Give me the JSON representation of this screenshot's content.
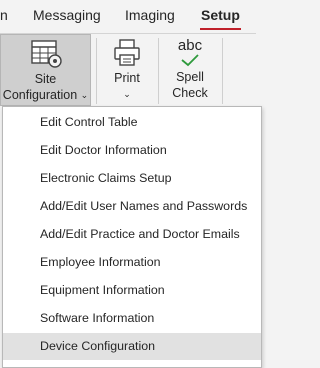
{
  "menubar": {
    "tabs": [
      {
        "label": "n"
      },
      {
        "label": "Messaging"
      },
      {
        "label": "Imaging"
      },
      {
        "label": "Setup",
        "active": true
      }
    ],
    "accent_color": "#c0202a"
  },
  "ribbon": {
    "site_configuration": {
      "line1": "Site",
      "line2": "Configuration",
      "caret": "⌄",
      "icon": "table-config-icon"
    },
    "print": {
      "label": "Print",
      "caret": "⌄",
      "icon": "printer-icon"
    },
    "spell_check": {
      "abc": "abc",
      "line1": "Spell",
      "line2": "Check",
      "icon": "spell-check-icon"
    }
  },
  "dropdown": {
    "items": [
      {
        "label": "Edit Control Table"
      },
      {
        "label": "Edit Doctor Information"
      },
      {
        "label": "Electronic Claims Setup"
      },
      {
        "label": "Add/Edit User Names and Passwords"
      },
      {
        "label": "Add/Edit Practice and Doctor Emails"
      },
      {
        "label": "Employee Information"
      },
      {
        "label": "Equipment Information"
      },
      {
        "label": "Software Information"
      },
      {
        "label": "Device Configuration"
      }
    ],
    "highlighted_index": 8
  }
}
